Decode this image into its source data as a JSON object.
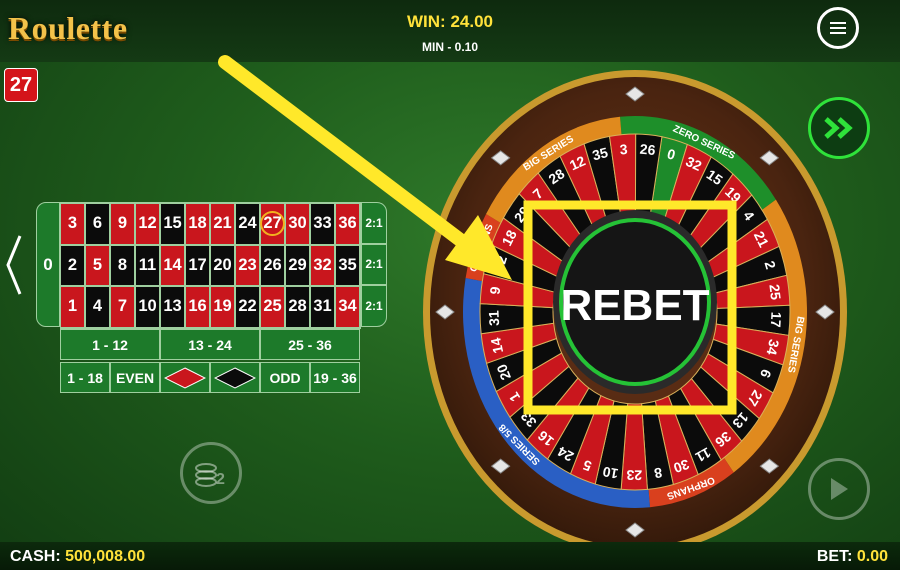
{
  "header": {
    "logo": "Roulette",
    "win_label": "WIN:",
    "win_value": "24.00",
    "min_label": "MIN - 0.10",
    "menu_icon": "hamburger-icon"
  },
  "last_number": "27",
  "board": {
    "zero": "0",
    "rows": [
      [
        {
          "n": "3",
          "c": "red"
        },
        {
          "n": "6",
          "c": "black"
        },
        {
          "n": "9",
          "c": "red"
        },
        {
          "n": "12",
          "c": "red"
        },
        {
          "n": "15",
          "c": "black"
        },
        {
          "n": "18",
          "c": "red"
        },
        {
          "n": "21",
          "c": "red"
        },
        {
          "n": "24",
          "c": "black"
        },
        {
          "n": "27",
          "c": "red",
          "hl": true
        },
        {
          "n": "30",
          "c": "red"
        },
        {
          "n": "33",
          "c": "black"
        },
        {
          "n": "36",
          "c": "red"
        }
      ],
      [
        {
          "n": "2",
          "c": "black"
        },
        {
          "n": "5",
          "c": "red"
        },
        {
          "n": "8",
          "c": "black"
        },
        {
          "n": "11",
          "c": "black"
        },
        {
          "n": "14",
          "c": "red"
        },
        {
          "n": "17",
          "c": "black"
        },
        {
          "n": "20",
          "c": "black"
        },
        {
          "n": "23",
          "c": "red"
        },
        {
          "n": "26",
          "c": "black"
        },
        {
          "n": "29",
          "c": "black"
        },
        {
          "n": "32",
          "c": "red"
        },
        {
          "n": "35",
          "c": "black"
        }
      ],
      [
        {
          "n": "1",
          "c": "red"
        },
        {
          "n": "4",
          "c": "black"
        },
        {
          "n": "7",
          "c": "red"
        },
        {
          "n": "10",
          "c": "black"
        },
        {
          "n": "13",
          "c": "black"
        },
        {
          "n": "16",
          "c": "red"
        },
        {
          "n": "19",
          "c": "red"
        },
        {
          "n": "22",
          "c": "black"
        },
        {
          "n": "25",
          "c": "red"
        },
        {
          "n": "28",
          "c": "black"
        },
        {
          "n": "31",
          "c": "black"
        },
        {
          "n": "34",
          "c": "red"
        }
      ]
    ],
    "columns": [
      "2:1",
      "2:1",
      "2:1"
    ],
    "dozens": [
      "1 - 12",
      "13 - 24",
      "25 - 36"
    ],
    "outside": [
      "1 - 18",
      "EVEN",
      "red-diamond",
      "black-diamond",
      "ODD",
      "19 - 36"
    ]
  },
  "wheel": {
    "center_label": "REBET",
    "numbers": [
      "0",
      "32",
      "15",
      "19",
      "4",
      "21",
      "2",
      "25",
      "17",
      "34",
      "6",
      "27",
      "13",
      "36",
      "11",
      "30",
      "8",
      "23",
      "10",
      "5",
      "24",
      "16",
      "33",
      "1",
      "20",
      "14",
      "31",
      "9",
      "22",
      "18",
      "29",
      "7",
      "28",
      "12",
      "35",
      "3",
      "26"
    ],
    "series_labels": [
      "ZERO SERIES",
      "BIG SERIES",
      "ORPHANS",
      "SERIES 5/8",
      "ORPHANS",
      "BIG SERIES"
    ]
  },
  "footer": {
    "cash_label": "CASH:",
    "cash_value": "500,008.00",
    "bet_label": "BET:",
    "bet_value": "0.00"
  },
  "colors": {
    "red": "#c9161d",
    "black": "#0b0b0b",
    "green": "#1d7a2a",
    "gold": "#f2b11f",
    "highlight": "#ffe82a"
  }
}
